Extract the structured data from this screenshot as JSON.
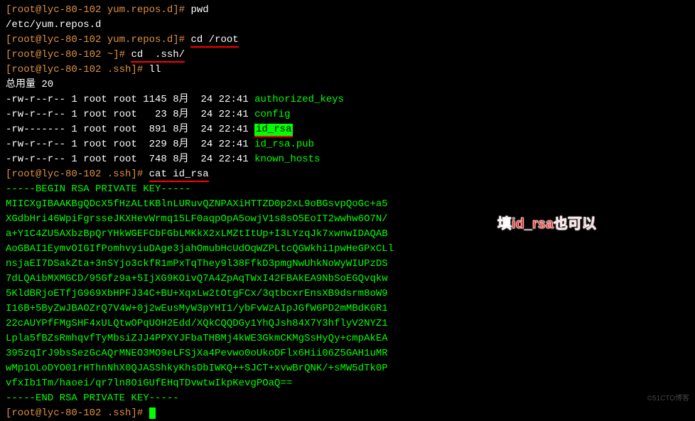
{
  "prompt1": {
    "user": "[root@lyc-80-102 yum.repos.d]# ",
    "cmd": "pwd"
  },
  "pwd_output": "/etc/yum.repos.d",
  "prompt2": {
    "user": "[root@lyc-80-102 yum.repos.d]# ",
    "cmd": "cd /root"
  },
  "prompt3": {
    "user": "[root@lyc-80-102 ~]# ",
    "cmd": "cd  .ssh/"
  },
  "prompt4": {
    "user": "[root@lyc-80-102 .ssh]# ",
    "cmd": "ll"
  },
  "total": "总用量 20",
  "files": [
    {
      "perm": "-rw-r--r-- 1 root root 1145 8月  24 22:41 ",
      "name": "authorized_keys",
      "hl": false
    },
    {
      "perm": "-rw-r--r-- 1 root root   23 8月  24 22:41 ",
      "name": "config",
      "hl": false
    },
    {
      "perm": "-rw------- 1 root root  891 8月  24 22:41 ",
      "name": "id_rsa",
      "hl": true
    },
    {
      "perm": "-rw-r--r-- 1 root root  229 8月  24 22:41 ",
      "name": "id_rsa.pub",
      "hl": false
    },
    {
      "perm": "-rw-r--r-- 1 root root  748 8月  24 22:41 ",
      "name": "known_hosts",
      "hl": false
    }
  ],
  "prompt5": {
    "user": "[root@lyc-80-102 .ssh]# ",
    "cmd": "cat id_rsa"
  },
  "key_begin": "-----BEGIN RSA PRIVATE KEY-----",
  "key_lines": [
    "MIICXgIBAAKBgQDcX5fHzALtKBlnLURuvQZNPAXiHTTZD0p2xL9oBGsvpQoGc+a5",
    "XGdbHri46WpiFgrsseJKXHevWrmq15LF0aqpOpA5owjV1s8sO5EoIT2wwhw6O7N/",
    "a+Y1C4ZU5AXbzBpQrYHkWGEFCbFGbLMKkX2xLMZtItUp+I3LYzqJk7xwnwIDAQAB",
    "AoGBAI1EymvOIGIfPomhvyiuDAge3jahOmubHcUdOqWZPLtcQGWkhi1pwHeGPxCLl",
    "nsjaEI7DSakZta+3nSYjo3ckfR1mPxTqThey9l38FfkD3pmgNwUhkNoWyWIUPzDS",
    "7dLQAibMXMGCD/95Gfz9a+5IjXG9KOivQ7A4ZpAqTWxI42FBAkEA9NbSoEGQvqkw",
    "5KldBRjoETfjG969XbHPFJ34C+BU+XqxLw2tOtgFCx/3qtbcxrEnsXB9dsrm8oW9",
    "I16B+5ByZwJBAOZrQ7V4W+0j2wEusMyW3pYHI1/ybFvWzAIpJGfW6PD2mMBdK6R1",
    "22cAUYPfFMgSHF4xULQtwOPqUOH2Edd/XQkCQQDGy1YhQJsh84X7Y3hflyV2NYZ1",
    "Lpla5fBZsRmhqvfTyMbsiZJJ4PPXYJFbaTHBMj4kWE3GkmCKMgSsHyQy+cmpAkEA",
    "395zqIrJ9bsSezGcAQrMNEO3MO9eLFSjXa4Pevwo0oUkoDFlx6Hii06Z5GAH1uMR",
    "wMp1OLoDYO01rHThnNhX0QJASShkyKhsDbIWKQ++SJCT+xvwBrQNK/+sMW5dTk0P",
    "vfxIb1Tm/haoei/qr7ln8OiGUfEHqTDvwtwIkpKevgPOaQ=="
  ],
  "key_end": "-----END RSA PRIVATE KEY-----",
  "prompt6": {
    "user": "[root@lyc-80-102 .ssh]# "
  },
  "annotation": "填id_rsa也可以",
  "watermark": "©51CTO博客"
}
